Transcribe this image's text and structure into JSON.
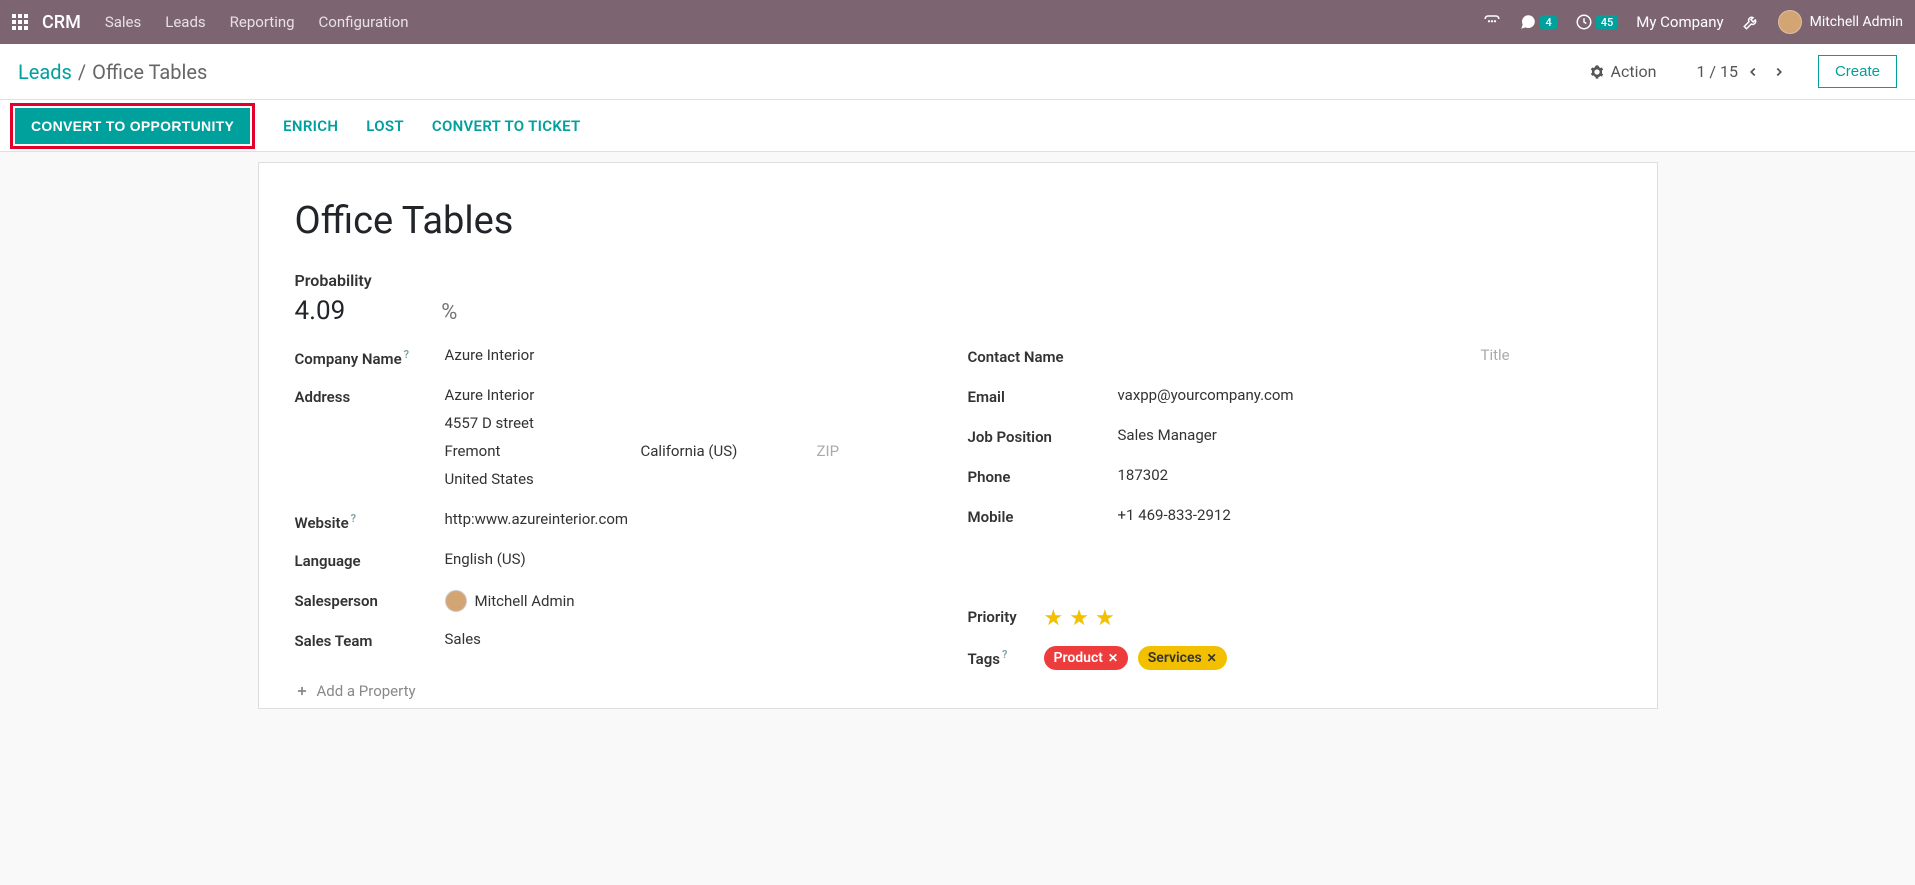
{
  "topnav": {
    "brand": "CRM",
    "links": [
      "Sales",
      "Leads",
      "Reporting",
      "Configuration"
    ],
    "chat_badge": "4",
    "clock_badge": "45",
    "company": "My Company",
    "user": "Mitchell Admin"
  },
  "breadcrumb": {
    "parent": "Leads",
    "current": "Office Tables",
    "action_label": "Action",
    "pager": "1 / 15",
    "create": "Create"
  },
  "statusbar": {
    "convert": "CONVERT TO OPPORTUNITY",
    "enrich": "ENRICH",
    "lost": "LOST",
    "ticket": "CONVERT TO TICKET"
  },
  "form": {
    "title": "Office Tables",
    "probability_label": "Probability",
    "probability": "4.09",
    "percent": "%",
    "labels": {
      "company": "Company Name",
      "address": "Address",
      "website": "Website",
      "language": "Language",
      "salesperson": "Salesperson",
      "sales_team": "Sales Team",
      "contact": "Contact Name",
      "email": "Email",
      "job": "Job Position",
      "phone": "Phone",
      "mobile": "Mobile",
      "priority": "Priority",
      "tags": "Tags",
      "title_placeholder": "Title",
      "zip_placeholder": "ZIP"
    },
    "company": "Azure Interior",
    "addr_name": "Azure Interior",
    "addr_street": "4557 D street",
    "addr_city": "Fremont",
    "addr_state": "California (US)",
    "addr_country": "United States",
    "website": "http:www.azureinterior.com",
    "language": "English (US)",
    "salesperson": "Mitchell Admin",
    "sales_team": "Sales",
    "email": "vaxpp@yourcompany.com",
    "job": "Sales Manager",
    "phone": "187302",
    "mobile": "+1 469-833-2912",
    "tags": [
      {
        "label": "Product",
        "color": "tag-red"
      },
      {
        "label": "Services",
        "color": "tag-yellow"
      }
    ],
    "add_property": "Add a Property",
    "help_mark": "?"
  }
}
